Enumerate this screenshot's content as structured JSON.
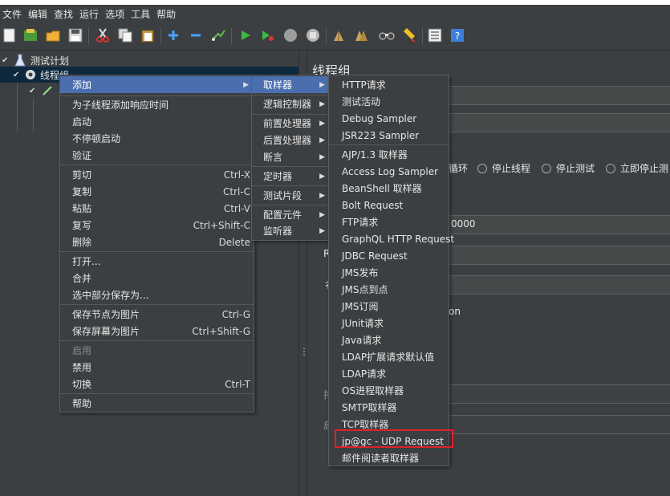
{
  "menubar": [
    "文件",
    "编辑",
    "查找",
    "运行",
    "选项",
    "工具",
    "帮助"
  ],
  "tree": {
    "test_plan": "测试计划",
    "thread_group": "线程组"
  },
  "right": {
    "title": "线程组",
    "radio_loop_suffix": "循环",
    "radio_stop_thread": "停止线程",
    "radio_stop_test": "停止测试",
    "radio_stop_now": "立即停止测",
    "field_value": "0000",
    "label_r": "R",
    "label_de": "彳",
    "label_on": "on",
    "label_chi": "持",
    "label_qi": "启"
  },
  "context_menu": {
    "items": [
      {
        "label": "添加",
        "shortcut": "",
        "submenu": true
      },
      {
        "label": "为子线程添加响应时间",
        "shortcut": ""
      },
      {
        "label": "启动",
        "shortcut": ""
      },
      {
        "label": "不停顿启动",
        "shortcut": ""
      },
      {
        "label": "验证",
        "shortcut": ""
      },
      {
        "label": "剪切",
        "shortcut": "Ctrl-X"
      },
      {
        "label": "复制",
        "shortcut": "Ctrl-C"
      },
      {
        "label": "粘贴",
        "shortcut": "Ctrl-V"
      },
      {
        "label": "复写",
        "shortcut": "Ctrl+Shift-C"
      },
      {
        "label": "删除",
        "shortcut": "Delete"
      },
      {
        "label": "打开...",
        "shortcut": ""
      },
      {
        "label": "合并",
        "shortcut": ""
      },
      {
        "label": "选中部分保存为...",
        "shortcut": ""
      },
      {
        "label": "保存节点为图片",
        "shortcut": "Ctrl-G"
      },
      {
        "label": "保存屏幕为图片",
        "shortcut": "Ctrl+Shift-G"
      },
      {
        "label": "启用",
        "shortcut": "",
        "disabled": true
      },
      {
        "label": "禁用",
        "shortcut": ""
      },
      {
        "label": "切换",
        "shortcut": "Ctrl-T"
      },
      {
        "label": "帮助",
        "shortcut": ""
      }
    ]
  },
  "add_submenu": {
    "items": [
      "取样器",
      "逻辑控制器",
      "前置处理器",
      "后置处理器",
      "断言",
      "定时器",
      "测试片段",
      "配置元件",
      "监听器"
    ]
  },
  "sampler_submenu": {
    "items": [
      "HTTP请求",
      "测试活动",
      "Debug Sampler",
      "JSR223 Sampler",
      "AJP/1.3 取样器",
      "Access Log Sampler",
      "BeanShell 取样器",
      "Bolt Request",
      "FTP请求",
      "GraphQL HTTP Request",
      "JDBC Request",
      "JMS发布",
      "JMS点到点",
      "JMS订阅",
      "JUnit请求",
      "Java请求",
      "LDAP扩展请求默认值",
      "LDAP请求",
      "OS进程取样器",
      "SMTP取样器",
      "TCP取样器",
      "jp@gc - UDP Request",
      "邮件阅读者取样器"
    ],
    "highlighted": "jp@gc - UDP Request",
    "highlight_color": "#e0202a"
  },
  "colors": {
    "background": "#3c3f41",
    "selection": "#4b6eaf",
    "text": "#e6e6e6"
  }
}
